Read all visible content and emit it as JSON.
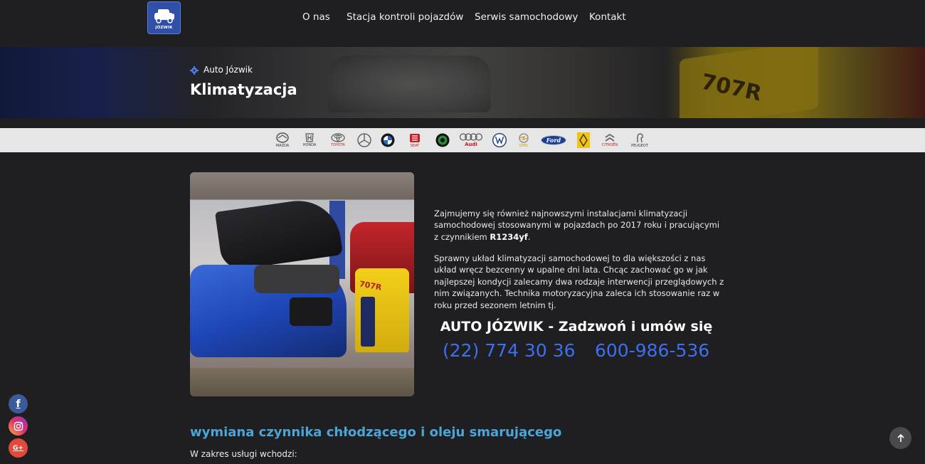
{
  "header": {
    "logo_text": "JÓZWIK",
    "nav": [
      "O nas",
      "Stacja kontroli pojazdów",
      "Serwis samochodowy",
      "Kontakt"
    ]
  },
  "hero": {
    "breadcrumb": "Auto Józwik",
    "title": "Klimatyzacja",
    "machine_label": "707R"
  },
  "brands": [
    {
      "name": "MAZDA",
      "icon": "mazda-logo"
    },
    {
      "name": "HONDA",
      "icon": "honda-logo"
    },
    {
      "name": "TOYOTA",
      "icon": "toyota-logo"
    },
    {
      "name": "",
      "icon": "mercedes-logo"
    },
    {
      "name": "",
      "icon": "bmw-logo"
    },
    {
      "name": "SEAT",
      "icon": "seat-logo"
    },
    {
      "name": "",
      "icon": "skoda-logo"
    },
    {
      "name": "Audi",
      "icon": "audi-logo"
    },
    {
      "name": "",
      "icon": "volkswagen-logo"
    },
    {
      "name": "OPEL",
      "icon": "opel-logo"
    },
    {
      "name": "Ford",
      "icon": "ford-logo"
    },
    {
      "name": "",
      "icon": "renault-logo"
    },
    {
      "name": "CITROËN",
      "icon": "citroen-logo"
    },
    {
      "name": "PEUGEOT",
      "icon": "peugeot-logo"
    }
  ],
  "content": {
    "photo_machine_label": "707R",
    "para1_text": "Zajmujemy się również najnowszymi instalacjami klimatyzacji samochodowej stosowanymi w pojazdach po 2017 roku i pracującymi z czynnikiem ",
    "para1_bold": "R1234yf",
    "para1_end": ".",
    "para2": "Sprawny układ klimatyzacji samochodowej to dla większości z nas układ wręcz bezcenny w upalne dni lata. Chcąc zachować go w jak najlepszej kondycji zalecamy dwa rodzaje interwencji przeglądowych z nim związanych. Technika motoryzacyjna zaleca ich stosowanie raz w roku przed sezonem letnim tj.",
    "cta": "AUTO JÓZWIK - Zadzwoń i umów się",
    "phone1": "(22) 774 30 36",
    "phone2": "600-986-536",
    "section_title": "wymiana czynnika chłodzącego i oleju smarującego",
    "scope": "W zakres usługi wchodzi:"
  },
  "social": {
    "facebook_glyph": "f",
    "google_glyph": "G+"
  },
  "colors": {
    "background": "#1f1e20",
    "accent_blue": "#3d6ff0",
    "section_title": "#4aa6d8",
    "brand_bar": "#e6e6e6"
  }
}
